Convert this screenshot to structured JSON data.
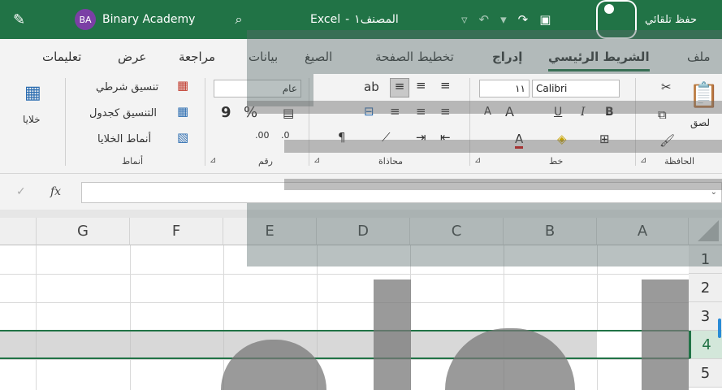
{
  "window": {
    "account_initials": "BA",
    "account_name": "Binary Academy",
    "app": "Excel",
    "separator": "-",
    "doc_name": "المصنف١",
    "autosave": "حفظ تلقائي"
  },
  "tabs": {
    "file": "ملف",
    "home": "الشريط الرئيسي",
    "insert": "إدراج",
    "page_layout": "تخطيط الصفحة",
    "formulas": "الصيغ",
    "data": "بيانات",
    "review": "مراجعة",
    "view": "عرض",
    "help": "تعليمات"
  },
  "ribbon": {
    "clipboard": {
      "label": "الحافظة",
      "paste": "لصق"
    },
    "font": {
      "label": "خط",
      "font_name": "Calibri",
      "font_size": "١١",
      "bold": "B",
      "italic": "I",
      "underline": "U",
      "grow": "A",
      "shrink": "A",
      "font_color": "A"
    },
    "alignment": {
      "label": "محاذاة"
    },
    "number": {
      "label": "رقم",
      "format": "عام",
      "percent": "%",
      "comma": "9",
      "inc_decimal": ".00",
      "dec_decimal": ".0"
    },
    "styles": {
      "label": "أنماط",
      "conditional": "تنسيق شرطي",
      "as_table": "التنسيق كجدول",
      "cell_styles": "أنماط الخلايا"
    },
    "cells": {
      "label": "خلايا"
    }
  },
  "formula_bar": {
    "fx": "fx",
    "value": ""
  },
  "grid": {
    "columns": [
      "A",
      "B",
      "C",
      "D",
      "E",
      "F",
      "G"
    ],
    "rows": [
      "1",
      "2",
      "3",
      "4",
      "5"
    ],
    "selected_row": "4"
  }
}
